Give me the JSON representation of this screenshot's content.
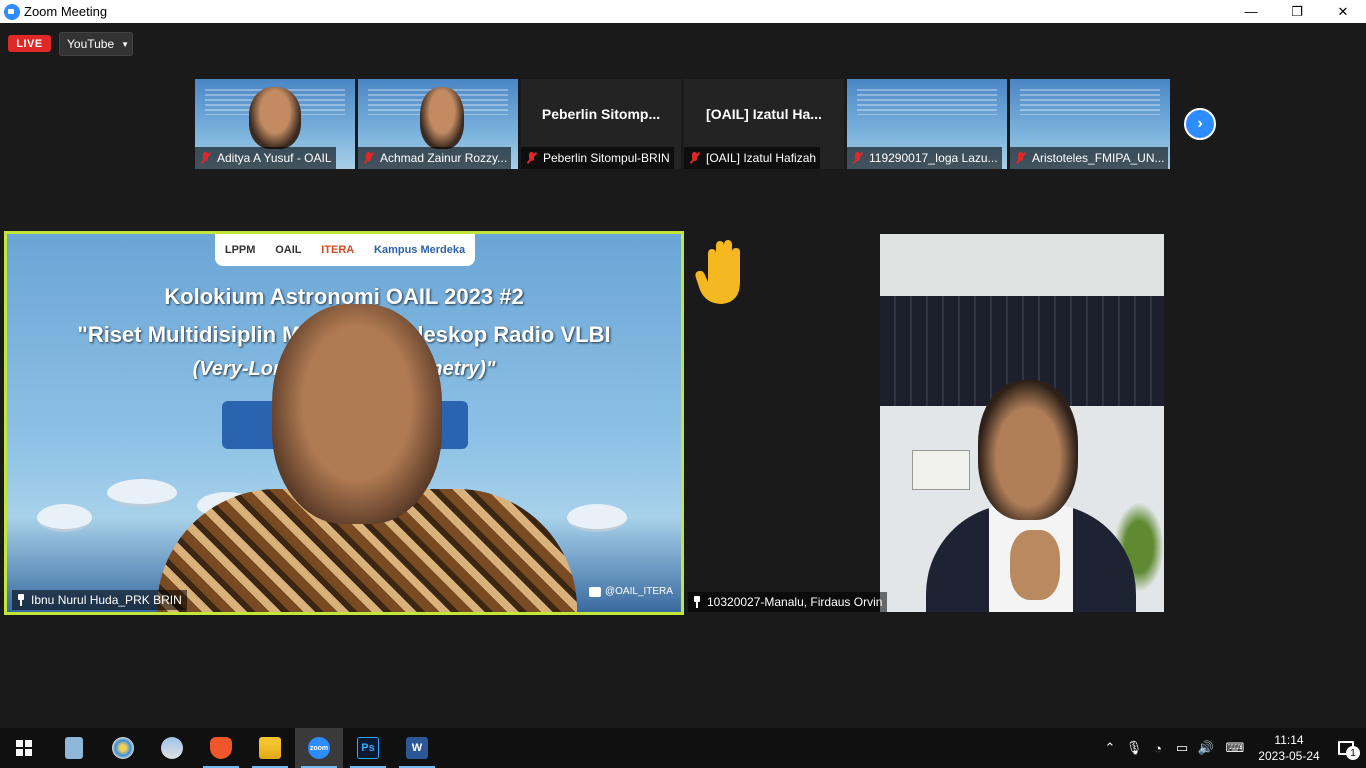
{
  "window": {
    "title": "Zoom Meeting",
    "minimize": "—",
    "restore": "❐",
    "close": "✕"
  },
  "toolbar": {
    "live_label": "LIVE",
    "stream_target": "YouTube"
  },
  "gallery_strip": {
    "tiles": [
      {
        "name": "Aditya A Yusuf - OAIL",
        "mic_muted": true,
        "video": true
      },
      {
        "name": "Achmad Zainur Rozzy...",
        "mic_muted": true,
        "video": true
      },
      {
        "name": "Peberlin Sitompul-BRIN",
        "display_name": "Peberlin  Sitomp...",
        "mic_muted": true,
        "video": false
      },
      {
        "name": "[OAIL] Izatul Hafizah",
        "display_name": "[OAIL]  Izatul  Ha...",
        "mic_muted": true,
        "video": false
      },
      {
        "name": "119290017_Ioga Lazu...",
        "mic_muted": true,
        "video": true
      },
      {
        "name": "Aristoteles_FMIPA_UN...",
        "mic_muted": true,
        "video": true
      }
    ],
    "next_icon": "chevron-right-icon"
  },
  "active_speaker": {
    "name": "Ibnu Nurul Huda_PRK BRIN",
    "slide": {
      "logos": [
        "LPPM",
        "OAIL",
        "ITERA",
        "Kampus Merdeka"
      ],
      "title": "Kolokium Astronomi OAIL 2023 #2",
      "subtitle": "\"Riset Multidisiplin Me          n Teleskop Radio VLBI",
      "subtitle2": "(Very-Long-L              erometry)\"",
      "social": "@OAIL_ITERA"
    },
    "highlight_color": "#c3e63a"
  },
  "second_participant": {
    "name": "10320027-Manalu, Firdaus Orvin",
    "reaction": "raised-hand"
  },
  "taskbar": {
    "apps": [
      "windows-start",
      "notepad",
      "paint",
      "cloud",
      "brave",
      "file-explorer",
      "zoom",
      "photoshop",
      "word"
    ],
    "active_app": "zoom",
    "clock_time": "11:14",
    "clock_date": "2023-05-24",
    "notification_count": "1"
  }
}
